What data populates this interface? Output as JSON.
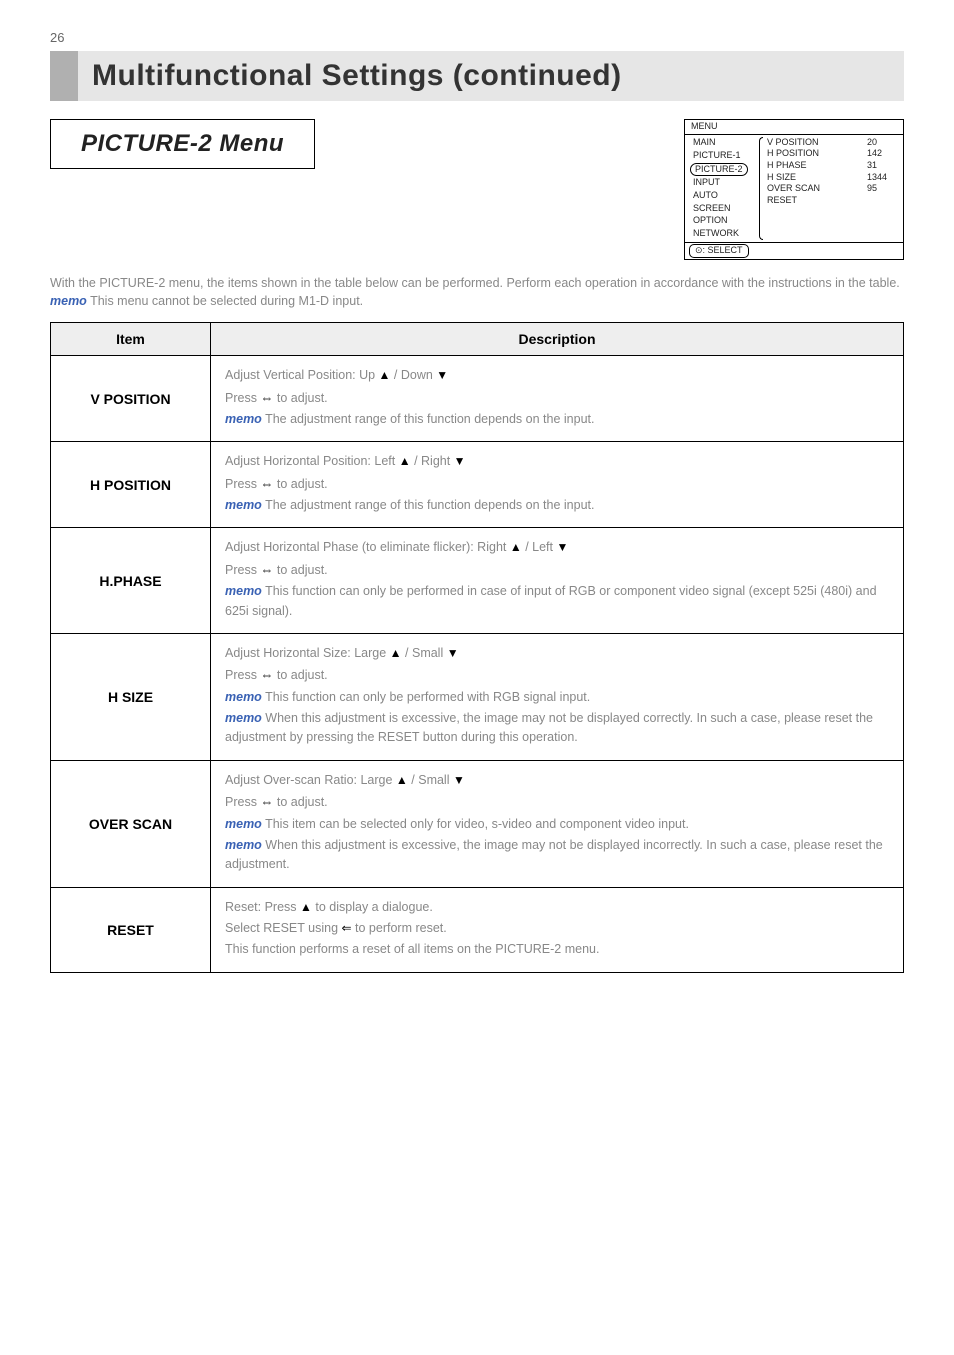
{
  "page_number": "26",
  "title": "Multifunctional Settings (continued)",
  "section_title": "PICTURE-2 Menu",
  "osd": {
    "header": "MENU",
    "left_items": [
      "MAIN",
      "PICTURE-1",
      "PICTURE-2",
      "INPUT",
      "AUTO",
      "SCREEN",
      "OPTION",
      "NETWORK"
    ],
    "selected_index": 2,
    "right_rows": [
      {
        "label": "V POSITION",
        "value": "20"
      },
      {
        "label": "H POSITION",
        "value": "142"
      },
      {
        "label": "H PHASE",
        "value": "31"
      },
      {
        "label": "H SIZE",
        "value": "1344"
      },
      {
        "label": "OVER SCAN",
        "value": "95"
      },
      {
        "label": "RESET",
        "value": ""
      }
    ],
    "footer": ": SELECT"
  },
  "intro": {
    "line1": "With the PICTURE-2 menu, the items shown in the table below can be performed. Perform each operation in accordance with the instructions in the table.",
    "memo_label": "memo",
    "memo_text": " This menu cannot be selected during M1-D input."
  },
  "table": {
    "headers": {
      "item": "Item",
      "desc": "Description"
    },
    "rows": [
      {
        "item": "V POSITION",
        "desc": {
          "l1a": "Adjust Vertical Position: Up ",
          "l1b": " / Down ",
          "l2a": "Press ",
          "l2b": " to adjust.",
          "memo": "memo",
          "memo_txt": " The adjustment range of this function depends on the input."
        }
      },
      {
        "item": "H POSITION",
        "desc": {
          "l1a": "Adjust Horizontal Position: Left ",
          "l1b": " / Right ",
          "l2a": "Press ",
          "l2b": " to adjust.",
          "memo": "memo",
          "memo_txt": " The adjustment range of this function depends on the input."
        }
      },
      {
        "item": "H.PHASE",
        "desc": {
          "l1a": "Adjust Horizontal Phase (to eliminate flicker): Right ",
          "l1b": " / Left ",
          "l2a": "Press ",
          "l2b": " to adjust.",
          "memo": "memo",
          "memo_txt": " This function can only be performed in case of input of RGB or component video signal (except 525i (480i) and 625i signal)."
        }
      },
      {
        "item": "H SIZE",
        "desc": {
          "l1a": "Adjust Horizontal Size: Large ",
          "l1b": " / Small ",
          "l2a": "Press ",
          "l2b": " to adjust.",
          "memo1": "memo",
          "memo1_txt": " This function can only be performed with RGB signal input.",
          "memo2": "memo",
          "memo2_txt": " When this adjustment is excessive, the image may not be displayed correctly. In such a case, please reset the adjustment by pressing the RESET button during this operation."
        }
      },
      {
        "item": "OVER SCAN",
        "desc": {
          "l1a": "Adjust Over-scan Ratio: Large ",
          "l1b": " / Small ",
          "l2a": "Press ",
          "l2b": " to adjust.",
          "memo1": "memo",
          "memo1_txt": " This item can be selected only for video, s-video and component video input.",
          "memo2": "memo",
          "memo2_txt": " When this adjustment is excessive, the image may not be displayed incorrectly. In such a case, please reset the adjustment."
        }
      },
      {
        "item": "RESET",
        "desc": {
          "l1a": "Reset: Press ",
          "l1b": " to display a dialogue.",
          "l2a": "Select RESET using ",
          "l2b": " to perform reset.",
          "l3": "This function performs a reset of all items on the PICTURE-2 menu."
        }
      }
    ]
  }
}
